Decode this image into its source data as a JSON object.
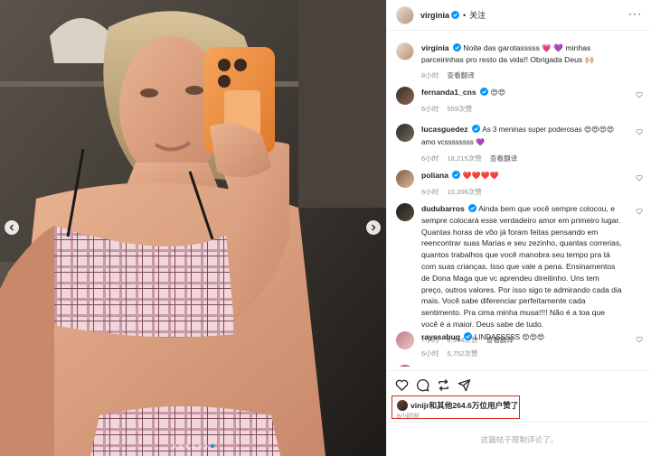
{
  "post": {
    "username": "virginia",
    "follow_label": "关注",
    "separator": "•",
    "caption": {
      "username": "virginia",
      "text": "Noite das garotasssss 💗 💜 minhas parceirinhas pro resto da vida!! Obrigada Deus 🙌🏼",
      "time": "8小时",
      "translate": "查看翻译"
    }
  },
  "comments": [
    {
      "username": "fernanda1_cns",
      "text": "😍😍",
      "time": "6小时",
      "likes": "559次赞",
      "translate": ""
    },
    {
      "username": "lucasguedez",
      "text": "As 3 meninas super poderosas 😍😍😍😍 amo vcssssssss 💜",
      "time": "6小时",
      "likes": "18,215次赞",
      "translate": "查看翻译"
    },
    {
      "username": "poliana",
      "text": "❤️❤️❤️❤️",
      "time": "6小时",
      "likes": "10,206次赞",
      "translate": ""
    },
    {
      "username": "dudubarros",
      "text": "Ainda bem que você sempre colocou, e sempre colocará esse verdadeiro amor em primeiro lugar. Quantas horas de vôo já foram feitas pensando em reencontrar suas Marias e seu zezinho, quantas correrias, quantos trabalhos que você manobra seu tempo pra tá com suas crianças. Isso que vale a pena. Ensinamentos de Dona Maga que vc aprendeu direitinho. Uns tem preço, outros valores. Por isso sigo te admirando cada dia mais. Você sabe diferenciar perfeitamente cada sentimento. Pra cima minha musa!!!! Não é a toa que você é a maior. Deus sabe de tudo.",
      "time": "7小时",
      "likes": "8,944次赞",
      "translate": "查看翻译"
    },
    {
      "username": "rayssabuq",
      "text": "LINDASSSSS 😍😍😍",
      "time": "6小时",
      "likes": "5,752次赞",
      "translate": ""
    }
  ],
  "likes_summary": {
    "user": "vinijr",
    "text": "和其他264.6万位用户赞了",
    "time": "8小时前"
  },
  "footer_text": "这篇帖子限制评论了。",
  "icons": {
    "like": "heart-icon",
    "comment": "comment-icon",
    "share": "share-icon",
    "send": "send-icon",
    "more": "more-icon",
    "verified": "verified-badge-icon"
  },
  "colors": {
    "verified": "#0095f6",
    "highlight_box": "#d7261e",
    "muted": "#8e8e8e"
  },
  "carousel": {
    "slide_count": 7,
    "active_index": 6
  }
}
